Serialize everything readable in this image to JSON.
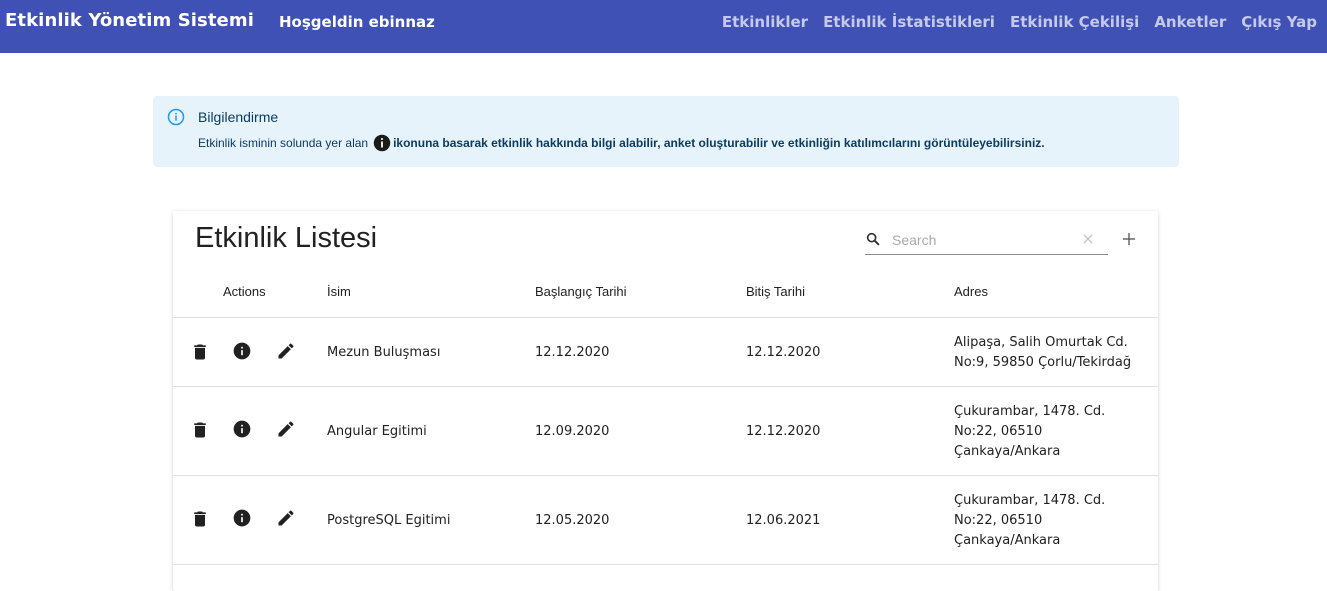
{
  "navbar": {
    "brand": "Etkinlik Yönetim Sistemi",
    "welcome": "Hoşgeldin ebinnaz",
    "links": [
      "Etkinlikler",
      "Etkinlik İstatistikleri",
      "Etkinlik Çekilişi",
      "Anketler",
      "Çıkış Yap"
    ],
    "background": "#3f51b5"
  },
  "alert": {
    "title": "Bilgilendirme",
    "body_prefix": "Etkinlik isminin solunda yer alan",
    "body_bold": "ikonuna basarak etkinlik hakkında bilgi alabilir, anket oluşturabilir ve etkinliğin katılımcılarını görüntüleyebilirsiniz.",
    "icon": "info-outline-icon"
  },
  "table": {
    "title": "Etkinlik Listesi",
    "search_placeholder": "Search",
    "search_value": "",
    "columns": [
      "Actions",
      "İsim",
      "Başlangıç Tarihi",
      "Bitiş Tarihi",
      "Adres"
    ],
    "rows": [
      {
        "name": "Mezun Buluşması",
        "start": "12.12.2020",
        "end": "12.12.2020",
        "address": "Alipaşa, Salih Omurtak Cd. No:9, 59850 Çorlu/Tekirdağ"
      },
      {
        "name": "Angular Egitimi",
        "start": "12.09.2020",
        "end": "12.12.2020",
        "address": "Çukurambar, 1478. Cd. No:22, 06510 Çankaya/Ankara"
      },
      {
        "name": "PostgreSQL Egitimi",
        "start": "12.05.2020",
        "end": "12.06.2021",
        "address": "Çukurambar, 1478. Cd. No:22, 06510 Çankaya/Ankara"
      }
    ]
  }
}
